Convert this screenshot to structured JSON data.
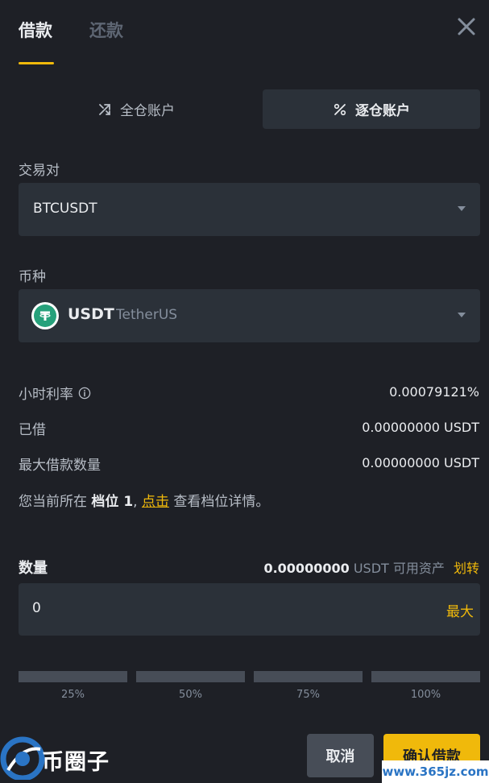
{
  "tabs": {
    "borrow": "借款",
    "repay": "还款"
  },
  "accounts": {
    "cross": "全仓账户",
    "isolated": "逐仓账户"
  },
  "pair": {
    "label": "交易对",
    "value": "BTCUSDT"
  },
  "coin": {
    "label": "币种",
    "code": "USDT",
    "name": "TetherUS"
  },
  "rows": {
    "hourly_rate_label": "小时利率",
    "hourly_rate_value": "0.00079121%",
    "borrowed_label": "已借",
    "borrowed_value": "0.00000000 USDT",
    "max_label": "最大借款数量",
    "max_value": "0.00000000 USDT"
  },
  "tier": {
    "prefix": "您当前所在",
    "level": "档位 1",
    "comma": ",",
    "link": "点击",
    "suffix": "查看档位详情。"
  },
  "quantity": {
    "label": "数量",
    "available_amount": "0.00000000",
    "available_unit": "USDT 可用资产",
    "transfer": "划转",
    "value": "0",
    "max": "最大"
  },
  "percents": [
    "25%",
    "50%",
    "75%",
    "100%"
  ],
  "buttons": {
    "cancel": "取消",
    "confirm": "确认借款"
  },
  "watermark": {
    "brand": "币圈子",
    "url": "www.365jz.com"
  },
  "colors": {
    "accent": "#f0b90b",
    "background": "#1e2026",
    "input": "#2b3139",
    "tether": "#26a17b"
  }
}
